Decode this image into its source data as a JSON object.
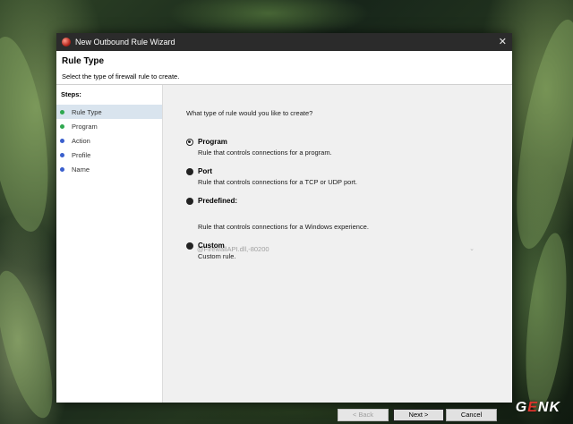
{
  "window": {
    "title": "New Outbound Rule Wizard",
    "close_glyph": "✕"
  },
  "header": {
    "title": "Rule Type",
    "description": "Select the type of firewall rule to create."
  },
  "steps": {
    "label": "Steps:",
    "items": [
      {
        "label": "Rule Type",
        "color": "#2fa84f",
        "current": true
      },
      {
        "label": "Program",
        "color": "#2fa84f",
        "current": false
      },
      {
        "label": "Action",
        "color": "#3a5fcd",
        "current": false
      },
      {
        "label": "Profile",
        "color": "#3a5fcd",
        "current": false
      },
      {
        "label": "Name",
        "color": "#3a5fcd",
        "current": false
      }
    ]
  },
  "content": {
    "question": "What type of rule would you like to create?",
    "options": [
      {
        "label": "Program",
        "description": "Rule that controls connections for a program.",
        "selected": true
      },
      {
        "label": "Port",
        "description": "Rule that controls connections for a TCP or UDP port.",
        "selected": false
      },
      {
        "label": "Predefined:",
        "description": "Rule that controls connections for a Windows experience.",
        "selected": false
      },
      {
        "label": "Custom",
        "description": "Custom rule.",
        "selected": false
      }
    ],
    "predefined_select": {
      "value": "@FirewallAPI.dll,-80200",
      "arrow": "⌄"
    }
  },
  "buttons": {
    "back": "< Back",
    "next": "Next >",
    "cancel": "Cancel"
  },
  "watermark": {
    "g": "G",
    "e": "E",
    "nk": "NK"
  }
}
